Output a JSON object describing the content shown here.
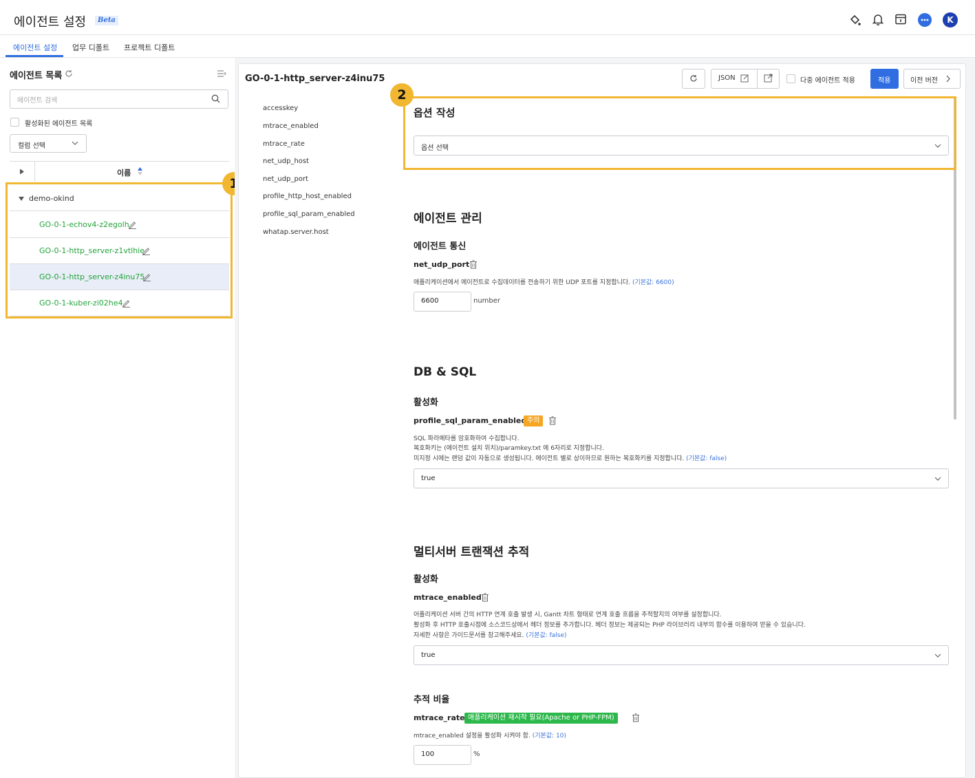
{
  "header": {
    "title": "에이전트 설정",
    "beta": "Beta",
    "tabs": [
      "에이전트 설정",
      "업무 디폴트",
      "프로젝트 디폴트"
    ],
    "avatar_letter": "K"
  },
  "sidebar": {
    "title": "에이전트 목록",
    "search_placeholder": "에이전트 검색",
    "active_only_label": "활성화된 에이전트 목록",
    "column_select": "컬럼 선택",
    "name_header": "이름",
    "group": "demo-okind",
    "agents": [
      "GO-0-1-echov4-z2egolh",
      "GO-0-1-http_server-z1vtlhie",
      "GO-0-1-http_server-z4inu75",
      "GO-0-1-kuber-zi02he4"
    ],
    "annotation": "1"
  },
  "toolbar": {
    "agent_title": "GO-0-1-http_server-z4inu75",
    "json_label": "JSON",
    "multi_agent_label": "다중 에이전트 적용",
    "apply_label": "적용",
    "prev_version_label": "이전 버전"
  },
  "option_nav": [
    "accesskey",
    "mtrace_enabled",
    "mtrace_rate",
    "net_udp_host",
    "net_udp_port",
    "profile_http_host_enabled",
    "profile_sql_param_enabled",
    "whatap.server.host"
  ],
  "option_write": {
    "annotation": "2",
    "title": "옵션 작성",
    "select_placeholder": "옵션 선택"
  },
  "agent_mgmt": {
    "title": "에이전트 관리",
    "subtitle": "에이전트 통신",
    "opt_name": "net_udp_port",
    "desc": "애플리케이션에서 에이전트로 수집데이터를 전송하기 위한 UDP 포트를 지정합니다.",
    "default_text": "(기본값: 6600)",
    "value": "6600",
    "unit": "number"
  },
  "db_sql": {
    "title": "DB & SQL",
    "subtitle": "활성화",
    "opt_name": "profile_sql_param_enabled",
    "badge": "주의",
    "desc1": "SQL 파라메타를 암호화하여 수집합니다.",
    "desc2": "복호화키는 (에이전트 설치 위치)/paramkey.txt 에 6자리로 지정합니다.",
    "desc3": "미지정 시에는 랜덤 값이 자동으로 생성됩니다. 에이전트 별로 상이하므로 원하는 복호화키를 지정합니다.",
    "default_text": "(기본값: false)",
    "value": "true"
  },
  "mtrace": {
    "title": "멀티서버 트랜잭션 추적",
    "subtitle": "활성화",
    "opt_name": "mtrace_enabled",
    "desc1": "어플리케이션 서버 간의 HTTP 연계 호출 발생 시, Gantt 차트 형태로 연계 호출 흐름을 추적할지의 여부를 설정합니다.",
    "desc2": "활성화 후 HTTP 호출시점에 소스코드상에서 헤더 정보를 추가합니다. 헤더 정보는 제공되는 PHP 라이브러리 내부의 함수를 이용하여 얻을 수 있습니다.",
    "desc3": "자세한 사항은 가이드문서를 참고해주세요.",
    "default_text": "(기본값: false)",
    "value": "true"
  },
  "rate": {
    "subtitle": "추적 비율",
    "opt_name": "mtrace_rate",
    "badge": "애플리케이션 재시작 필요(Apache or PHP-FPM)",
    "desc": "mtrace_enabled 설정을 활성화 시켜야 함.",
    "default_text": "(기본값: 10)",
    "value": "100",
    "unit": "%"
  },
  "colors": {
    "accent": "#2f6de1",
    "highlight": "#f2b731",
    "agent_green": "#22a33a",
    "warn_orange": "#f5a623",
    "restart_green": "#2db84b"
  }
}
